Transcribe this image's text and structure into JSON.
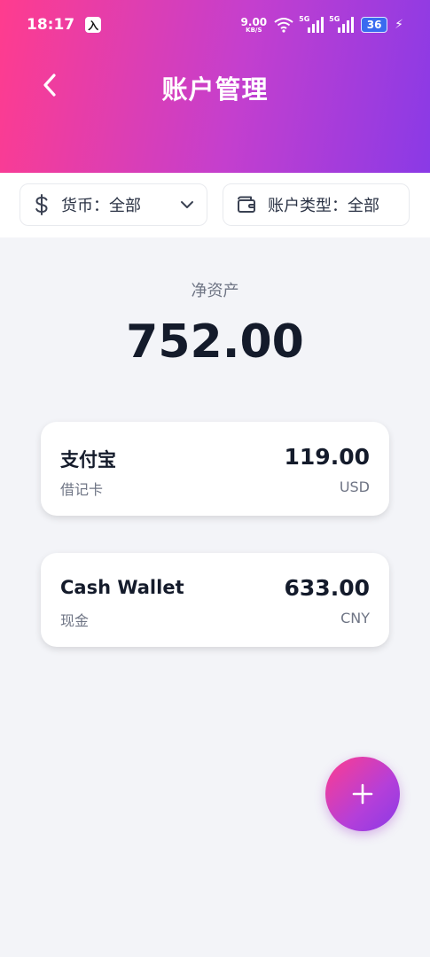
{
  "status_bar": {
    "time": "18:17",
    "app_badge": "入",
    "net_speed_value": "9.00",
    "net_speed_unit": "KB/S",
    "sim1_label": "5G",
    "sim2_label": "5G",
    "battery": "36",
    "icons": [
      "wifi-icon",
      "signal-icon",
      "signal-icon",
      "charging-bolt-icon"
    ]
  },
  "header": {
    "title": "账户管理",
    "back_icon": "chevron-left-icon"
  },
  "filters": {
    "currency": {
      "label": "货币：全部",
      "icon": "dollar-icon",
      "dropdown_icon": "chevron-down-icon"
    },
    "account_type": {
      "label": "账户类型：全部",
      "icon": "wallet-icon"
    }
  },
  "summary": {
    "net_assets_label": "净资产",
    "net_assets_value": "752.00"
  },
  "accounts": [
    {
      "name": "支付宝",
      "type": "借记卡",
      "amount": "119.00",
      "currency": "USD"
    },
    {
      "name": "Cash Wallet",
      "type": "现金",
      "amount": "633.00",
      "currency": "CNY"
    }
  ],
  "fab": {
    "icon": "plus-icon"
  },
  "colors": {
    "header_gradient_start": "#ff3c8e",
    "header_gradient_end": "#8a3ae6",
    "background": "#f3f4f8",
    "text_primary": "#141b2b",
    "text_secondary": "#6f7585"
  }
}
